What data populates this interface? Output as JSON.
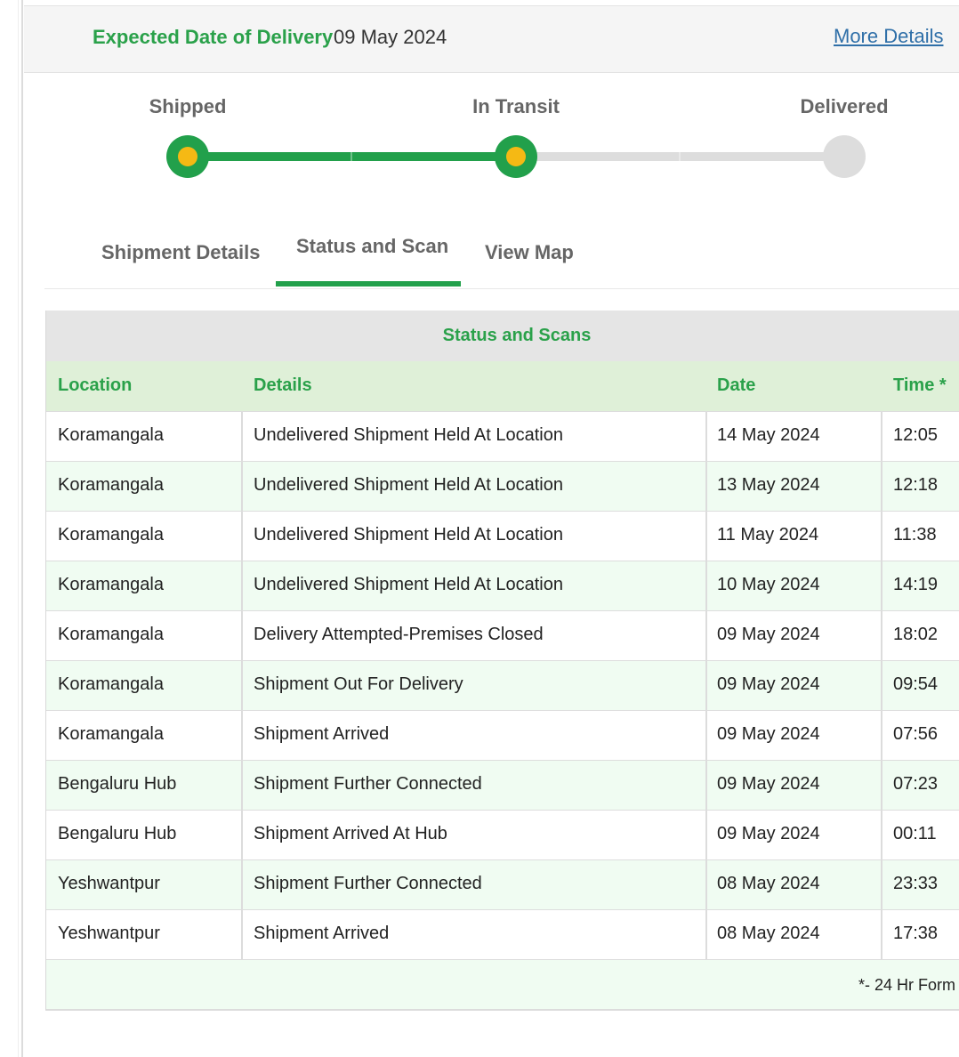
{
  "header": {
    "edd_label": "Expected Date of Delivery",
    "edd_date": "09 May 2024",
    "more_details_label": "More Details"
  },
  "tracker": {
    "steps": [
      {
        "label": "Shipped",
        "status": "done"
      },
      {
        "label": "In Transit",
        "status": "done"
      },
      {
        "label": "Delivered",
        "status": "pending"
      }
    ],
    "colors": {
      "done": "#22a04b",
      "active_dot": "#f5b914",
      "pending": "#dddddd"
    }
  },
  "tabs": [
    {
      "label": "Shipment Details",
      "selected": false
    },
    {
      "label": "Status and Scan",
      "selected": true
    },
    {
      "label": "View Map",
      "selected": false
    }
  ],
  "scans": {
    "title": "Status and Scans",
    "columns": [
      "Location",
      "Details",
      "Date",
      "Time *"
    ],
    "rows": [
      {
        "location": "Koramangala",
        "details": "Undelivered Shipment Held At Location",
        "date": "14 May 2024",
        "time": "12:05"
      },
      {
        "location": "Koramangala",
        "details": "Undelivered Shipment Held At Location",
        "date": "13 May 2024",
        "time": "12:18"
      },
      {
        "location": "Koramangala",
        "details": "Undelivered Shipment Held At Location",
        "date": "11 May 2024",
        "time": "11:38"
      },
      {
        "location": "Koramangala",
        "details": "Undelivered Shipment Held At Location",
        "date": "10 May 2024",
        "time": "14:19"
      },
      {
        "location": "Koramangala",
        "details": "Delivery Attempted-Premises Closed",
        "date": "09 May 2024",
        "time": "18:02"
      },
      {
        "location": "Koramangala",
        "details": "Shipment Out For Delivery",
        "date": "09 May 2024",
        "time": "09:54"
      },
      {
        "location": "Koramangala",
        "details": "Shipment Arrived",
        "date": "09 May 2024",
        "time": "07:56"
      },
      {
        "location": "Bengaluru Hub",
        "details": "Shipment Further Connected",
        "date": "09 May 2024",
        "time": "07:23"
      },
      {
        "location": "Bengaluru Hub",
        "details": "Shipment Arrived At Hub",
        "date": "09 May 2024",
        "time": "00:11"
      },
      {
        "location": "Yeshwantpur",
        "details": "Shipment Further Connected",
        "date": "08 May 2024",
        "time": "23:33"
      },
      {
        "location": "Yeshwantpur",
        "details": "Shipment Arrived",
        "date": "08 May 2024",
        "time": "17:38"
      }
    ],
    "footnote": "*- 24 Hr Form"
  }
}
